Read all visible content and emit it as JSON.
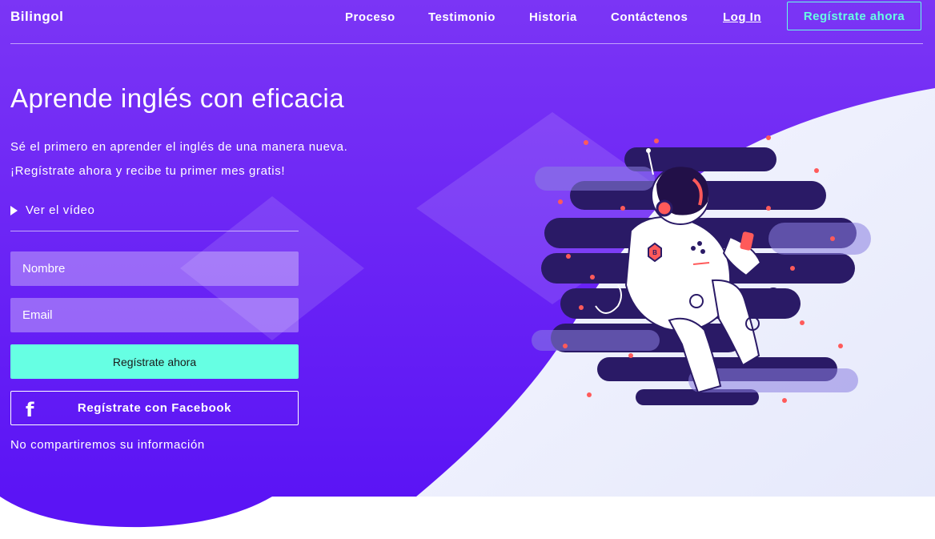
{
  "header": {
    "logo": "Bilingol",
    "nav": [
      "Proceso",
      "Testimonio",
      "Historia",
      "Contáctenos"
    ],
    "login": "Log In",
    "register": "Regístrate ahora"
  },
  "hero": {
    "title": "Aprende inglés con eficacia",
    "subtitle_1": "Sé el primero en aprender el inglés de una manera nueva.",
    "subtitle_2": "¡Regístrate ahora y recibe tu primer mes gratis!",
    "video_link": "Ver el vídeo"
  },
  "form": {
    "name_placeholder": "Nombre",
    "email_placeholder": "Email",
    "submit_label": "Regístrate ahora",
    "facebook_label": "Regístrate con Facebook",
    "facebook_icon": "facebook-icon",
    "privacy_note": "No compartiremos su información"
  },
  "colors": {
    "accent": "#66ffe3",
    "hero_top": "#7b35f5",
    "hero_bottom": "#5b14f5",
    "wave": "#eef2fd",
    "space": "#2a1a66"
  },
  "illustration": {
    "badge_letter": "B"
  }
}
